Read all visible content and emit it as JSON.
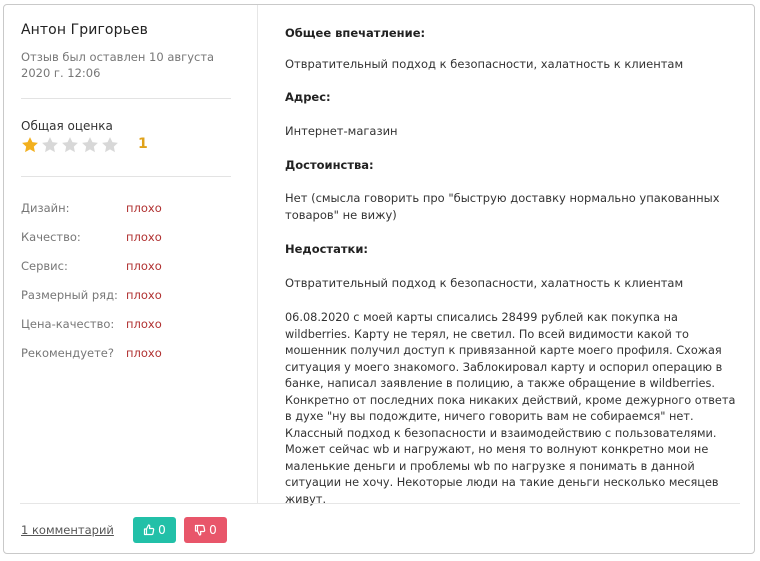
{
  "review": {
    "author": "Антон Григорьев",
    "date_line1": "Отзыв был оставлен 10 августа",
    "date_line2": "2020 г. 12:06",
    "overall_label": "Общая оценка",
    "overall_value": "1",
    "stars_total": 5,
    "stars_filled": 1,
    "star_color": "#f2b01e",
    "star_empty_color": "#d8d8d8",
    "params": [
      {
        "name": "Дизайн:",
        "value": "плохо"
      },
      {
        "name": "Качество:",
        "value": "плохо"
      },
      {
        "name": "Сервис:",
        "value": "плохо"
      },
      {
        "name": "Размерный ряд:",
        "value": "плохо"
      },
      {
        "name": "Цена-качество:",
        "value": "плохо"
      },
      {
        "name": "Рекомендуете?",
        "value": "плохо"
      }
    ]
  },
  "sections": {
    "impression_title": "Общее впечатление:",
    "impression_text": "Отвратительный подход к безопасности, халатность к клиентам",
    "address_title": "Адрес:",
    "address_text": "Интернет-магазин",
    "pros_title": "Достоинства:",
    "pros_text": "Нет (смысла говорить про \"быструю доставку нормально упакованных товаров\" не вижу)",
    "cons_title": "Недостатки:",
    "cons_text": "Отвратительный подход к безопасности, халатность к клиентам",
    "body_text": "06.08.2020 с моей карты списались 28499 рублей как покупка на wildberries. Карту не терял, не светил. По всей видимости какой то мошенник получил доступ к привязанной карте моего профиля. Схожая ситуация у моего знакомого. Заблокировал карту и оспорил операцию в банке, написал заявление в полицию, а также обращение в wildberries. Конкретно от последних пока никаких действий, кроме дежурного ответа в духе \"ну вы подождите, ничего говорить вам не собираемся\" нет. Классный подход к безопасности и взаимодействию с пользователями. Может сейчас wb и нагружают, но меня то волнуют конкретно мои не маленькие деньги и проблемы wb по нагрузке я понимать в данной ситуации не хочу. Некоторые люди на такие деньги несколько месяцев живут."
  },
  "footer": {
    "comments_link": "1 комментарий",
    "like_count": "0",
    "dislike_count": "0",
    "like_color": "#22c0a8",
    "dislike_color": "#e8566a",
    "like_icon": "thumbs-up-icon",
    "dislike_icon": "thumbs-down-icon"
  }
}
